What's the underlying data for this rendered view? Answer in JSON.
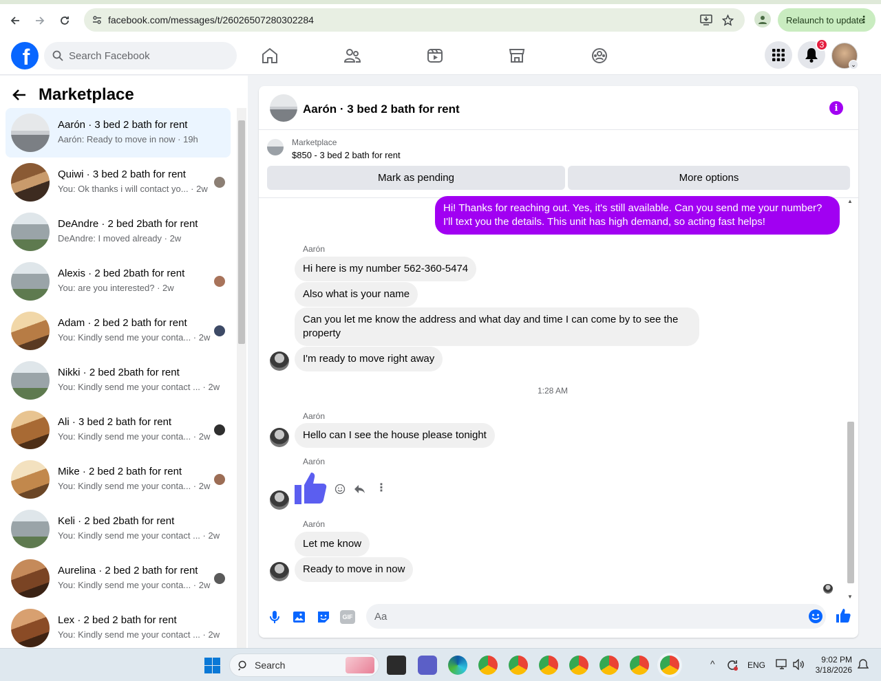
{
  "browser": {
    "url": "facebook.com/messages/t/26026507280302284",
    "relaunch_label": "Relaunch to update"
  },
  "header": {
    "search_placeholder": "Search Facebook",
    "notification_count": "3",
    "logo_letter": "f"
  },
  "sidebar": {
    "title": "Marketplace",
    "conversations": [
      {
        "title": "Aarón · 3 bed 2 bath for rent",
        "subtitle": "Aarón: Ready to move in now · 19h",
        "active": true
      },
      {
        "title": "Quiwi · 3 bed 2 bath for rent",
        "subtitle": "You: Ok thanks i will contact yo... · 2w"
      },
      {
        "title": "DeAndre · 2 bed 2bath for rent",
        "subtitle": "DeAndre: I moved already · 2w"
      },
      {
        "title": "Alexis · 2 bed 2bath for rent",
        "subtitle": "You: are you interested? · 2w"
      },
      {
        "title": "Adam · 2 bed 2 bath for rent",
        "subtitle": "You: Kindly send me your conta... · 2w"
      },
      {
        "title": "Nikki · 2 bed 2bath for rent",
        "subtitle": "You: Kindly send me your contact ... · 2w"
      },
      {
        "title": "Ali · 3 bed 2 bath for rent",
        "subtitle": "You: Kindly send me your conta... · 2w"
      },
      {
        "title": "Mike · 2 bed 2 bath for rent",
        "subtitle": "You: Kindly send me your conta... · 2w"
      },
      {
        "title": "Keli · 2 bed 2bath for rent",
        "subtitle": "You: Kindly send me your contact ... · 2w"
      },
      {
        "title": "Aurelina · 2 bed 2 bath for rent",
        "subtitle": "You: Kindly send me your conta... · 2w"
      },
      {
        "title": "Lex · 2 bed 2 bath for rent",
        "subtitle": "You: Kindly send me your contact ... · 2w"
      }
    ]
  },
  "chat": {
    "title": "Aarón · 3 bed 2 bath for rent",
    "marketplace_label": "Marketplace",
    "listing": "$850 - 3 bed 2 bath for rent",
    "mark_pending": "Mark as pending",
    "more_options": "More options",
    "outgoing_1": "Hi! Thanks for reaching out. Yes, it's still available. Can you send me your number? I'll text you the details. This unit has high demand, so acting fast helps!",
    "sender": "Aarón",
    "in_1": "Hi here is my number 562-360-5474",
    "in_2": "Also what is your name",
    "in_3": "Can you let me know the address and what day and time I can come by to see the property",
    "in_4": "I'm ready to move right away",
    "timestamp": "1:28 AM",
    "in_5": "Hello can I see the house please tonight",
    "in_6": "Let me know",
    "in_7": "Ready to move in now",
    "input_placeholder": "Aa"
  },
  "taskbar": {
    "search_label": "Search",
    "language": "ENG",
    "time": "9:02 PM",
    "date": "3/18/2026"
  },
  "colors": {
    "fb_blue": "#0866ff",
    "messenger_purple": "#a100f2",
    "notification_red": "#e41e3f"
  }
}
